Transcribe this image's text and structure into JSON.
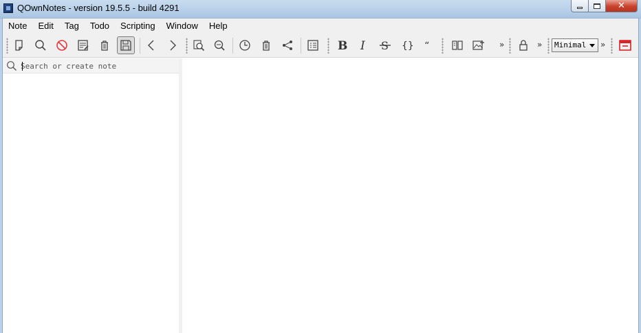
{
  "window": {
    "title": "QOwnNotes - version 19.5.5 - build 4291"
  },
  "menu": {
    "items": [
      "Note",
      "Edit",
      "Tag",
      "Todo",
      "Scripting",
      "Window",
      "Help"
    ]
  },
  "toolbar": {
    "buttons": [
      {
        "name": "new-note",
        "icon": "new-note-icon"
      },
      {
        "name": "search",
        "icon": "search-icon"
      },
      {
        "name": "remove",
        "icon": "forbidden-icon"
      },
      {
        "name": "edit-note",
        "icon": "edit-note-icon"
      },
      {
        "name": "delete-note",
        "icon": "trash-icon"
      },
      {
        "name": "save",
        "icon": "save-icon",
        "pressed": true
      },
      {
        "name": "back",
        "icon": "chevron-left-icon"
      },
      {
        "name": "forward",
        "icon": "chevron-right-icon"
      },
      {
        "name": "find-in-notes",
        "icon": "find-in-note-icon"
      },
      {
        "name": "find",
        "icon": "zoom-icon"
      },
      {
        "name": "history",
        "icon": "clock-icon"
      },
      {
        "name": "trash",
        "icon": "trash-icon"
      },
      {
        "name": "share",
        "icon": "share-icon"
      },
      {
        "name": "table-of-contents",
        "icon": "list-icon"
      },
      {
        "name": "bold",
        "icon": "bold-icon"
      },
      {
        "name": "italic",
        "icon": "italic-icon"
      },
      {
        "name": "strikeout",
        "icon": "strikethrough-icon"
      },
      {
        "name": "code-block",
        "icon": "braces-icon"
      },
      {
        "name": "quote",
        "icon": "quote-icon"
      },
      {
        "name": "column-view",
        "icon": "columns-icon"
      },
      {
        "name": "insert-image",
        "icon": "image-icon"
      },
      {
        "name": "encrypt",
        "icon": "lock-icon"
      },
      {
        "name": "distraction-free",
        "icon": "distraction-free-icon"
      }
    ],
    "overflow_glyph": "»",
    "mode_select": {
      "selected": "Minimal"
    }
  },
  "search": {
    "placeholder": "Search or create note"
  },
  "colors": {
    "accent_red": "#d9232b",
    "titlebar": "#bcd3ea",
    "chrome": "#f0f0f0"
  }
}
